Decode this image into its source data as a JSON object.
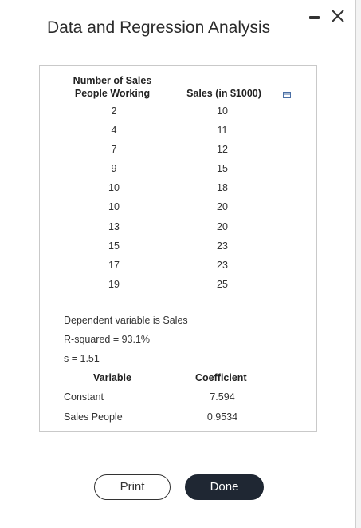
{
  "window": {
    "title": "Data and Regression Analysis"
  },
  "table": {
    "headers": {
      "left_line1": "Number of Sales",
      "left_line2": "People Working",
      "right": "Sales (in $1000)"
    },
    "rows": [
      {
        "people": "2",
        "sales": "10"
      },
      {
        "people": "4",
        "sales": "11"
      },
      {
        "people": "7",
        "sales": "12"
      },
      {
        "people": "9",
        "sales": "15"
      },
      {
        "people": "10",
        "sales": "18"
      },
      {
        "people": "10",
        "sales": "20"
      },
      {
        "people": "13",
        "sales": "20"
      },
      {
        "people": "15",
        "sales": "23"
      },
      {
        "people": "17",
        "sales": "23"
      },
      {
        "people": "19",
        "sales": "25"
      }
    ]
  },
  "regression": {
    "dependent": "Dependent variable is Sales",
    "r_squared": "R-squared = 93.1%",
    "s": "s = 1.51",
    "col_variable": "Variable",
    "col_coefficient": "Coefficient",
    "rows": [
      {
        "variable": "Constant",
        "coefficient": "7.594"
      },
      {
        "variable": "Sales People",
        "coefficient": "0.9534"
      }
    ]
  },
  "buttons": {
    "print": "Print",
    "done": "Done"
  },
  "icons": {
    "minimize": "minimize-icon",
    "close": "close-icon",
    "expand": "expand-icon"
  }
}
